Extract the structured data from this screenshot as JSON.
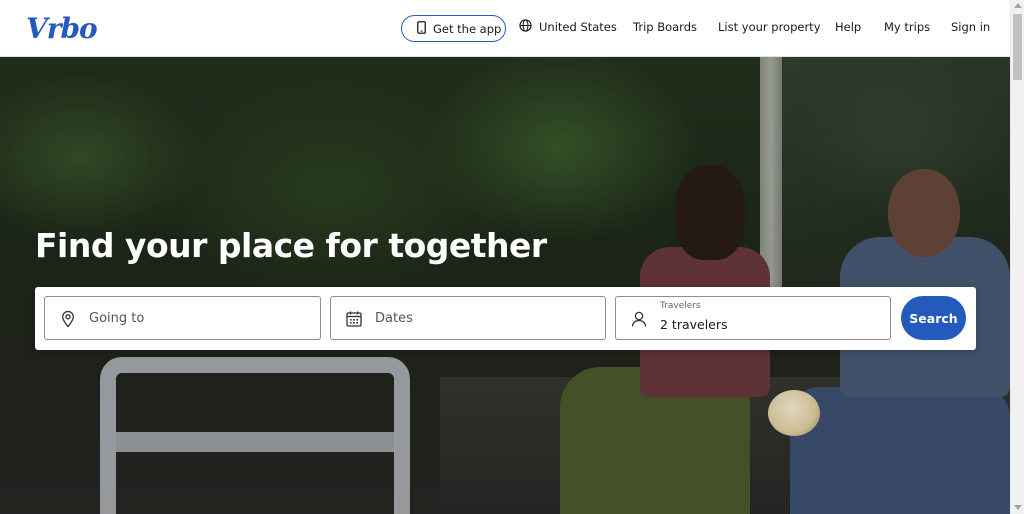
{
  "header": {
    "logo": "Vrbo",
    "get_app_label": "Get the app",
    "nav": {
      "country": "United States",
      "trip_boards": "Trip Boards",
      "list_property": "List your property",
      "help": "Help",
      "my_trips": "My trips",
      "sign_in": "Sign in"
    }
  },
  "hero": {
    "title": "Find your place for together"
  },
  "search": {
    "going_to_placeholder": "Going to",
    "dates_placeholder": "Dates",
    "travelers_label": "Travelers",
    "travelers_value": "2 travelers",
    "search_label": "Search"
  },
  "colors": {
    "brand_blue": "#245abc",
    "text": "#1a1a1a",
    "border": "#8f8f8f"
  },
  "icons": [
    "phone-icon",
    "globe-icon",
    "location-pin-icon",
    "calendar-icon",
    "person-icon"
  ]
}
